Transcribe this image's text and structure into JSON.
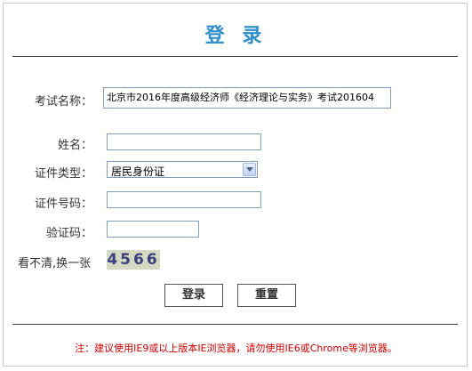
{
  "title": "登 录",
  "form": {
    "exam_name_label": "考试名称：",
    "exam_name_value": "北京市2016年度高级经济师《经济理论与实务》考试201604",
    "name_label": "姓名：",
    "name_value": "",
    "id_type_label": "证件类型：",
    "id_type_value": "居民身份证",
    "id_number_label": "证件号码：",
    "id_number_value": "",
    "captcha_label": "验证码：",
    "captcha_value": "",
    "refresh_captcha_label": "看不清,换一张",
    "captcha_image_text": "4566"
  },
  "buttons": {
    "login_label": "登录",
    "reset_label": "重置"
  },
  "note": "注：建议使用IE9或以上版本IE浏览器，请勿使用IE6或Chrome等浏览器。",
  "colors": {
    "title": "#2f8fc8",
    "note": "#cc0000",
    "field_border": "#7f9db9"
  }
}
